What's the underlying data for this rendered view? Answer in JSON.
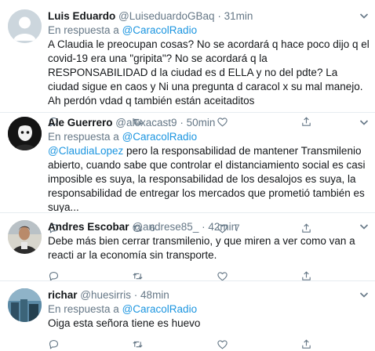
{
  "tweets": [
    {
      "name": "Luis Eduardo",
      "handle": "@LuiseduardoGBaq",
      "dot": "·",
      "time": "31min",
      "reply_prefix": "En respuesta a",
      "reply_to": "@CaracolRadio",
      "mention": "",
      "body": "A Claudia le preocupan cosas? No se acordará q hace poco dijo q el covid-19 era una \"gripita\"? No se acordará q la RESPONSABILIDAD d la ciudad es d ELLA y no del pdte? La ciudad sigue en caos y Ni una pregunta d caracol x su mal manejo. Ah perdón vdad q también están aceitaditos",
      "retweets": "",
      "likes": ""
    },
    {
      "name": "Ale Guerrero",
      "handle": "@alexacast9",
      "dot": "·",
      "time": "50min",
      "reply_prefix": "",
      "reply_to": "",
      "mention": "@ClaudiaLopez",
      "body": " pero la responsabilidad de mantener Transmilenio abierto, cuando sabe que controlar el distanciamiento social es casi imposible es suya, la responsabilidad de los desalojos es suya, la responsabilidad de entregar los mercados que prometió también es suya...",
      "retweets": "6",
      "likes": "7"
    },
    {
      "name": "Andres Escobar",
      "handle": "@andrese85_",
      "dot": "·",
      "time": "42min",
      "reply_prefix": "",
      "reply_to": "",
      "mention": "",
      "body": "Debe más bien cerrar transmilenio, y que miren a ver como van a reacti ar la economía sin transporte.",
      "retweets": "",
      "likes": ""
    },
    {
      "name": "richar",
      "handle": "@huesirris",
      "dot": "·",
      "time": "48min",
      "reply_prefix": "En respuesta a",
      "reply_to": "@CaracolRadio",
      "mention": "",
      "body": "Oiga esta señora tiene es huevo",
      "retweets": "",
      "likes": ""
    }
  ],
  "colors": {
    "link": "#1b95e0",
    "muted": "#657786",
    "text": "#14171a",
    "separator": "#e6ecf0"
  },
  "icons": [
    "reply-icon",
    "retweet-icon",
    "like-icon",
    "share-icon",
    "chevron-down-icon"
  ]
}
